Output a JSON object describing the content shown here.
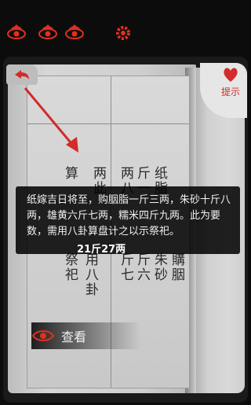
{
  "hud": {
    "icons": [
      "flaming-eye-icon",
      "flaming-eye-icon",
      "flaming-eye-icon",
      "gear-icon"
    ]
  },
  "book": {
    "columns": [
      "纸脂",
      "斤一",
      "两此",
      "算",
      "两八",
      "斤六",
      "朱砂",
      "斤七",
      "購胭",
      "祭祀",
      "用八卦"
    ]
  },
  "dialog": {
    "text": "纸嫁吉日将至，购胭脂一斤三两，朱砂十斤八两，雄黄六斤七两，糯米四斤九两。此为要数，需用八卦算盘计之以示祭祀。",
    "answer": "21斤27两"
  },
  "controls": {
    "hint_label": "提示",
    "view_label": "查看"
  },
  "colors": {
    "accent_red": "#d22b2b",
    "dialog_bg": "#000000"
  }
}
